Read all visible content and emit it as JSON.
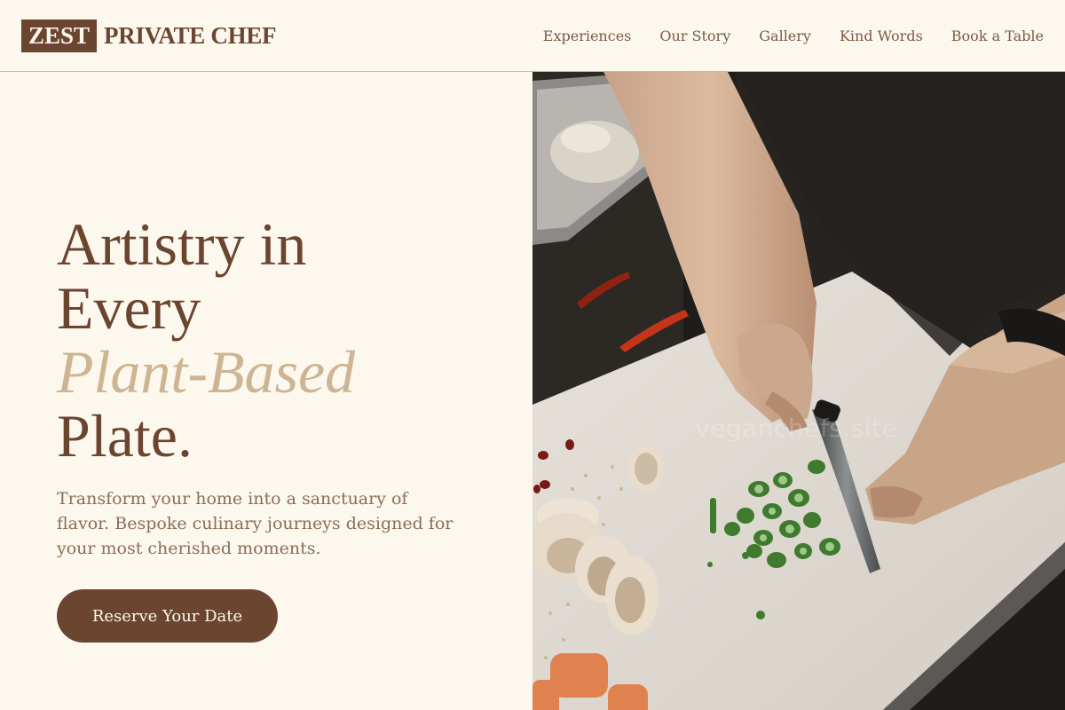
{
  "brand": {
    "mark": "ZEST",
    "name": "PRIVATE CHEF"
  },
  "nav": {
    "items": [
      {
        "label": "Experiences"
      },
      {
        "label": "Our Story"
      },
      {
        "label": "Gallery"
      },
      {
        "label": "Kind Words"
      },
      {
        "label": "Book a Table"
      }
    ]
  },
  "hero": {
    "headline": {
      "line1": "Artistry in",
      "line2": "Every",
      "accent": "Plant-Based",
      "line4": "Plate."
    },
    "subtitle": "Transform your home into a sanctuary of flavor. Bespoke culinary journeys designed for your most cherished moments.",
    "cta_label": "Reserve Your Date",
    "image_watermark": "veganchefs.site"
  },
  "colors": {
    "background": "#fdf8ee",
    "brand_brown": "#6b4530",
    "accent_tan": "#cdb493",
    "body_text": "#8a6e58",
    "divider": "#cbb79c"
  }
}
